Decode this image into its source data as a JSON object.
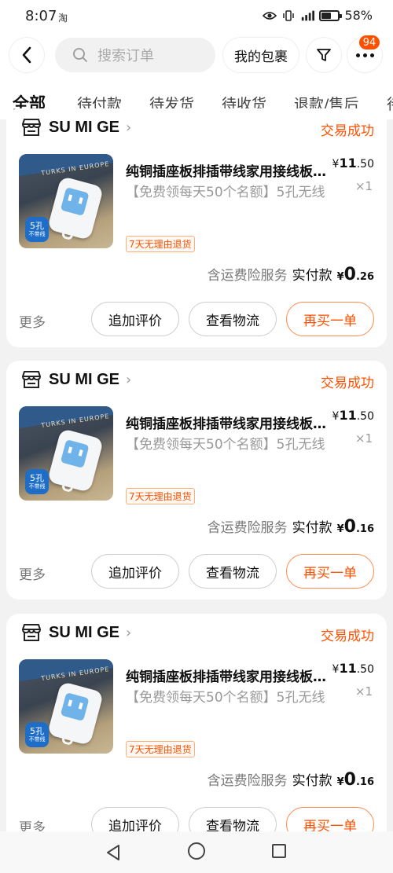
{
  "status_bar": {
    "time": "8:07",
    "app_icon": "淘",
    "battery": "58%",
    "battery_level": 0.58
  },
  "nav": {
    "search_placeholder": "搜索订单",
    "my_package": "我的包裹",
    "badge_count": "94"
  },
  "tabs": [
    {
      "label": "全部",
      "active": true
    },
    {
      "label": "待付款"
    },
    {
      "label": "待发货"
    },
    {
      "label": "待收货"
    },
    {
      "label": "退款/售后"
    },
    {
      "label": "待"
    }
  ],
  "orders": [
    {
      "shop": "SU MI GE",
      "status": "交易成功",
      "title": "纯铜插座板排插带线家用接线板拖线板多孔插排",
      "subtitle": "【免费领每天50个名额】5孔无线",
      "tag": "7天无理由退货",
      "price_currency": "¥",
      "price_int": "11",
      "price_dec": ".50",
      "qty": "×1",
      "service": "含运费险服务",
      "paid_label": "实付款",
      "paid_currency": "¥",
      "paid_int": "0",
      "paid_dec": ".26",
      "more": "更多",
      "btn_review": "追加评价",
      "btn_logistics": "查看物流",
      "btn_rebuy": "再买一单",
      "thumb_label_a": "5孔",
      "thumb_label_b": "不带线",
      "thumb_box_text": "TURKS IN EUROPE"
    },
    {
      "shop": "SU MI GE",
      "status": "交易成功",
      "title": "纯铜插座板排插带线家用接线板拖线板多孔插排",
      "subtitle": "【免费领每天50个名额】5孔无线",
      "tag": "7天无理由退货",
      "price_currency": "¥",
      "price_int": "11",
      "price_dec": ".50",
      "qty": "×1",
      "service": "含运费险服务",
      "paid_label": "实付款",
      "paid_currency": "¥",
      "paid_int": "0",
      "paid_dec": ".16",
      "more": "更多",
      "btn_review": "追加评价",
      "btn_logistics": "查看物流",
      "btn_rebuy": "再买一单",
      "thumb_label_a": "5孔",
      "thumb_label_b": "不带线",
      "thumb_box_text": "TURKS IN EUROPE"
    },
    {
      "shop": "SU MI GE",
      "status": "交易成功",
      "title": "纯铜插座板排插带线家用接线板拖线板多孔插排",
      "subtitle": "【免费领每天50个名额】5孔无线",
      "tag": "7天无理由退货",
      "price_currency": "¥",
      "price_int": "11",
      "price_dec": ".50",
      "qty": "×1",
      "service": "含运费险服务",
      "paid_label": "实付款",
      "paid_currency": "¥",
      "paid_int": "0",
      "paid_dec": ".16",
      "more": "更多",
      "btn_review": "追加评价",
      "btn_logistics": "查看物流",
      "btn_rebuy": "再买一单",
      "thumb_label_a": "5孔",
      "thumb_label_b": "不带线",
      "thumb_box_text": "TURKS IN EUROPE"
    }
  ],
  "colors": {
    "accent": "#ff5000",
    "background": "#f2f2f2"
  },
  "icons": [
    "back-icon",
    "search-icon",
    "filter-icon",
    "more-icon",
    "shop-icon",
    "nav-back-icon",
    "nav-home-icon",
    "nav-recents-icon"
  ]
}
